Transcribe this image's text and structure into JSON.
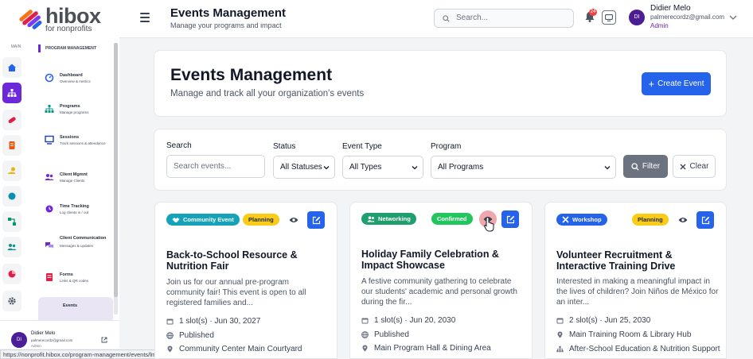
{
  "brand": {
    "name": "hibox",
    "tagline": "for nonprofits"
  },
  "topbar": {
    "title": "Events Management",
    "subtitle": "Manage your programs and impact",
    "search_placeholder": "Search...",
    "notification_count": "24",
    "user": {
      "initials": "DI",
      "name": "Didier Melo",
      "email": "palmerecordz@gmail.com",
      "role": "Admin"
    }
  },
  "rail": {
    "section_label": "MAIN"
  },
  "sidebar": {
    "section_title": "PROGRAM MANAGEMENT",
    "items": [
      {
        "label": "Dashboard",
        "sub": "Overview & metrics"
      },
      {
        "label": "Programs",
        "sub": "Manage programs"
      },
      {
        "label": "Sessions",
        "sub": "Track sessions & attendance"
      },
      {
        "label": "Client Mgmnt",
        "sub": "Manage Clients"
      },
      {
        "label": "Time Tracking",
        "sub": "Log clients in / out"
      },
      {
        "label": "Client Communication",
        "sub": "Messages & updates"
      },
      {
        "label": "Forms",
        "sub": "Links & QR codes"
      },
      {
        "label": "Events",
        "sub": ""
      }
    ],
    "user": {
      "initials": "DI",
      "name": "Didier Melo",
      "email": "palmerecordz@gmail.com",
      "role": "Admin"
    }
  },
  "status_url": "https://nonprofit.hibox.co/program-management/events/lmn648gP",
  "hero": {
    "title": "Events Management",
    "subtitle": "Manage and track all your organization's events",
    "create_label": "Create Event"
  },
  "filters": {
    "search_label": "Search",
    "search_placeholder": "Search events...",
    "status_label": "Status",
    "status_value": "All Statuses",
    "type_label": "Event Type",
    "type_value": "All Types",
    "program_label": "Program",
    "program_value": "All Programs",
    "filter_label": "Filter",
    "clear_label": "Clear"
  },
  "events": [
    {
      "type": "Community Event",
      "status": "Planning",
      "title": "Back-to-School Resource & Nutrition Fair",
      "description": "Join us for our annual pre-program community fair! This event is open to all registered families and...",
      "slots": "1 slot(s) · Jun 30, 2027",
      "publish": "Published",
      "location": "Community Center Main Courtyard"
    },
    {
      "type": "Networking",
      "status": "Confirmed",
      "title": "Holiday Family Celebration & Impact Showcase",
      "description": "A festive community gathering to celebrate our students' academic and personal growth during the fir...",
      "slots": "1 slot(s) · Jun 20, 2030",
      "publish": "Published",
      "location": "Main Program Hall & Dining Area"
    },
    {
      "type": "Workshop",
      "status": "Planning",
      "title": "Volunteer Recruitment & Interactive Training Drive",
      "description": "Interested in making a meaningful impact in the lives of children? Join Niños de México for an inter...",
      "slots": "2 slot(s) · Jun 25, 2030",
      "location": "Main Training Room & Library Hub",
      "program": "After-School Education & Nutrition Support"
    }
  ],
  "colors": {
    "primary": "#2563eb",
    "brand_purple": "#6d28d9",
    "planning": "#facc15",
    "confirmed": "#22c55e"
  }
}
